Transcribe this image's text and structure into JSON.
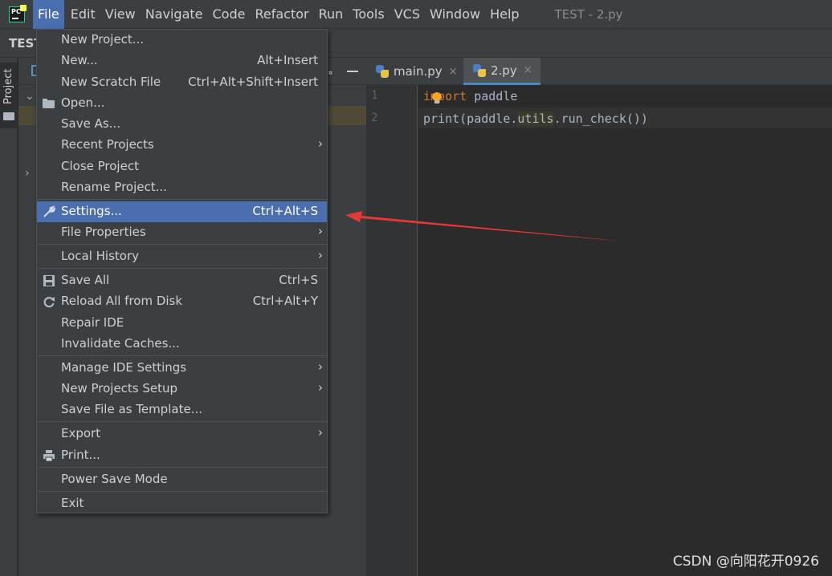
{
  "menubar": {
    "items": [
      {
        "label": "File",
        "u": "F"
      },
      {
        "label": "Edit",
        "u": "E"
      },
      {
        "label": "View",
        "u": "V"
      },
      {
        "label": "Navigate",
        "u": "N"
      },
      {
        "label": "Code",
        "u": "C"
      },
      {
        "label": "Refactor",
        "u": "R"
      },
      {
        "label": "Run",
        "u": "u"
      },
      {
        "label": "Tools",
        "u": "T"
      },
      {
        "label": "VCS",
        "u": "S"
      },
      {
        "label": "Window",
        "u": "W"
      },
      {
        "label": "Help",
        "u": "H"
      }
    ],
    "window_title": "TEST - 2.py"
  },
  "navbar": {
    "breadcrumb": "TEST"
  },
  "tool_stripe": {
    "project_label": "Project"
  },
  "editor": {
    "tabs": [
      {
        "label": "main.py",
        "close": "×"
      },
      {
        "label": "2.py",
        "close": "×"
      }
    ],
    "lines": [
      {
        "no": "1"
      },
      {
        "no": "2"
      }
    ],
    "code": {
      "line1_kw": "import",
      "line1_rest": " paddle",
      "line2_a": "print(paddle.",
      "line2_hl": "utils",
      "line2_b": ".run_check())"
    }
  },
  "file_menu": {
    "items": {
      "new_project": {
        "label": "New Project..."
      },
      "new": {
        "label": "New...",
        "shortcut": "Alt+Insert"
      },
      "new_scratch": {
        "label": "New Scratch File",
        "shortcut": "Ctrl+Alt+Shift+Insert"
      },
      "open": {
        "label": "Open..."
      },
      "save_as": {
        "label": "Save As..."
      },
      "recent_projects": {
        "label": "Recent Projects",
        "submenu": "›"
      },
      "close_project": {
        "label": "Close Project"
      },
      "rename_project": {
        "label": "Rename Project..."
      },
      "settings": {
        "label": "Settings...",
        "shortcut": "Ctrl+Alt+S"
      },
      "file_properties": {
        "label": "File Properties",
        "submenu": "›"
      },
      "local_history": {
        "label": "Local History",
        "submenu": "›"
      },
      "save_all": {
        "label": "Save All",
        "shortcut": "Ctrl+S"
      },
      "reload_all": {
        "label": "Reload All from Disk",
        "shortcut": "Ctrl+Alt+Y"
      },
      "repair_ide": {
        "label": "Repair IDE"
      },
      "invalidate_caches": {
        "label": "Invalidate Caches..."
      },
      "manage_ide_settings": {
        "label": "Manage IDE Settings",
        "submenu": "›"
      },
      "new_projects_setup": {
        "label": "New Projects Setup",
        "submenu": "›"
      },
      "save_file_as_template": {
        "label": "Save File as Template..."
      },
      "export": {
        "label": "Export",
        "submenu": "›"
      },
      "print": {
        "label": "Print..."
      },
      "power_save_mode": {
        "label": "Power Save Mode"
      },
      "exit": {
        "label": "Exit"
      }
    }
  },
  "watermark": "CSDN @向阳花开0926",
  "colors": {
    "menu_bg": "#3c3f41",
    "selection": "#4b6eaf",
    "editor_bg": "#2b2b2b",
    "keyword": "#cc7832",
    "annotation_arrow": "#e53935"
  }
}
